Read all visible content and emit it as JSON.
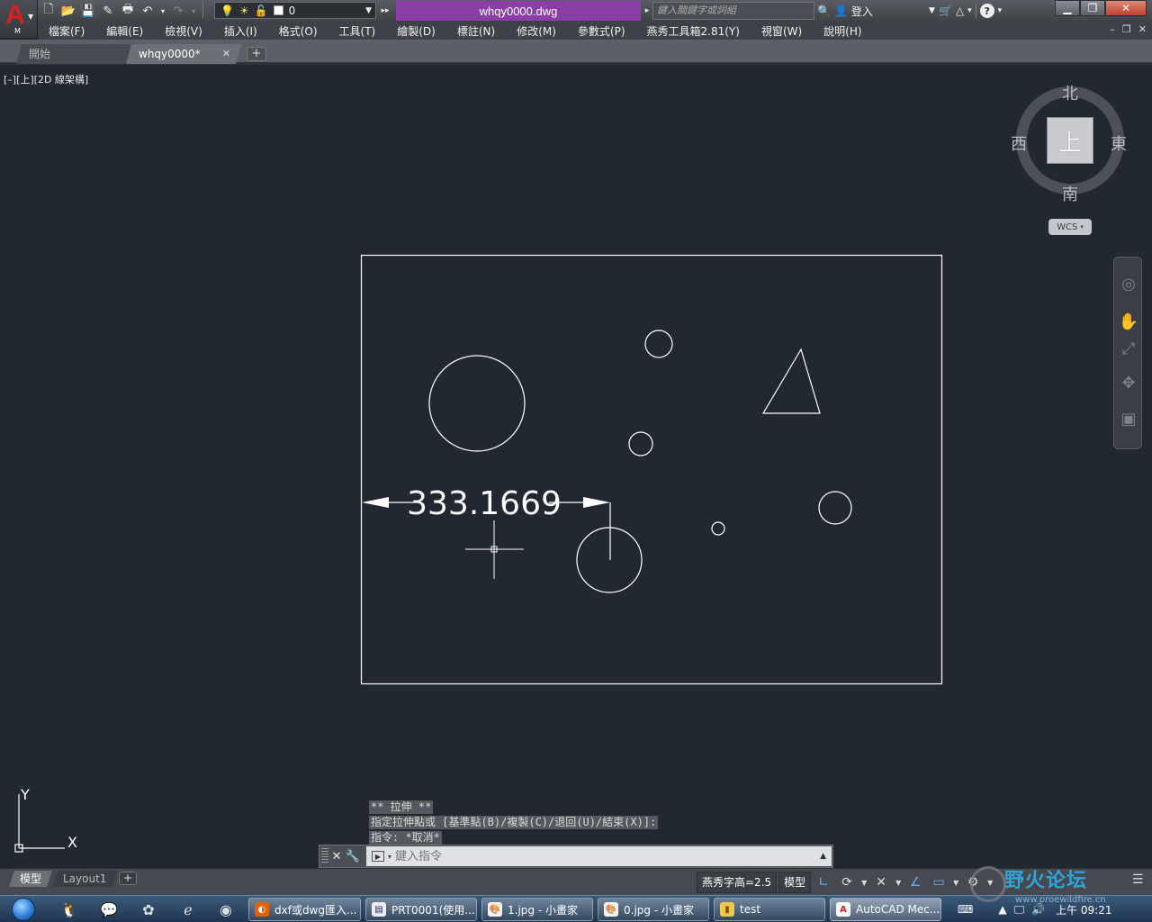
{
  "titlebar": {
    "app_letter": "A",
    "app_sub": "M",
    "layer_name": "0",
    "document_title": "whqy0000.dwg",
    "search_placeholder": "鍵入關鍵字或詞組",
    "sign_in": "登入",
    "help": "?"
  },
  "menu": [
    "檔案(F)",
    "編輯(E)",
    "檢視(V)",
    "插入(I)",
    "格式(O)",
    "工具(T)",
    "繪製(D)",
    "標註(N)",
    "修改(M)",
    "參數式(P)",
    "燕秀工具箱2.81(Y)",
    "視窗(W)",
    "說明(H)"
  ],
  "file_tabs": {
    "start": "開始",
    "doc": "whqy0000*"
  },
  "viewport": {
    "label": "[–][上][2D 線架構]"
  },
  "drawing": {
    "dimension_text": "333.1669"
  },
  "viewcube": {
    "north": "北",
    "south": "南",
    "east": "東",
    "west": "西",
    "face": "上",
    "wcs": "WCS"
  },
  "ucs": {
    "x_label": "X",
    "y_label": "Y"
  },
  "command": {
    "history": [
      "** 拉伸 **",
      "指定拉伸點或 [基準點(B)/複製(C)/退回(U)/結束(X)]:",
      "指令: *取消*"
    ],
    "placeholder": "鍵入指令"
  },
  "layout_tabs": [
    "模型",
    "Layout1"
  ],
  "status": {
    "text_height": "燕秀字高=2.5",
    "model": "模型"
  },
  "taskbar": {
    "tasks": [
      "dxf或dwg匯入...",
      "PRT0001(使用...",
      "1.jpg - 小畫家",
      "0.jpg - 小畫家",
      "test",
      "AutoCAD Mec..."
    ],
    "clock": "上午 09:21"
  },
  "watermark": {
    "text": "野火论坛",
    "sub": "www.proewildfire.cn"
  }
}
